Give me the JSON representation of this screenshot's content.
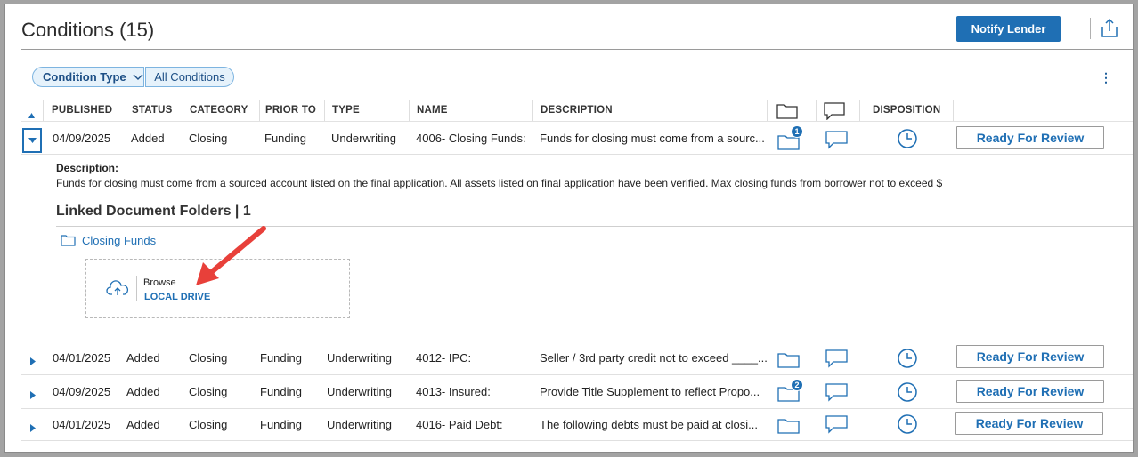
{
  "page": {
    "title": "Conditions (15)",
    "notify_label": "Notify Lender",
    "share_icon": "share-export-icon"
  },
  "filters": {
    "condition_type_label": "Condition Type",
    "all_conditions_label": "All Conditions"
  },
  "table": {
    "columns": [
      "PUBLISHED",
      "STATUS",
      "CATEGORY",
      "PRIOR TO",
      "TYPE",
      "NAME",
      "DESCRIPTION",
      "DISPOSITION"
    ],
    "action_label": "Ready For Review",
    "rows": [
      {
        "published": "04/09/2025",
        "status": "Added",
        "category": "Closing",
        "prior_to": "Funding",
        "type": "Underwriting",
        "name": "4006- Closing Funds:",
        "description": "Funds for closing must come from a sourc...",
        "folder_count": "1"
      },
      {
        "published": "04/01/2025",
        "status": "Added",
        "category": "Closing",
        "prior_to": "Funding",
        "type": "Underwriting",
        "name": "4012- IPC:",
        "description": "Seller / 3rd party credit not to exceed ____...",
        "folder_count": ""
      },
      {
        "published": "04/09/2025",
        "status": "Added",
        "category": "Closing",
        "prior_to": "Funding",
        "type": "Underwriting",
        "name": "4013- Insured:",
        "description": "Provide Title Supplement to reflect Propo...",
        "folder_count": "2"
      },
      {
        "published": "04/01/2025",
        "status": "Added",
        "category": "Closing",
        "prior_to": "Funding",
        "type": "Underwriting",
        "name": "4016- Paid Debt:",
        "description": "The following debts must be paid at closi...",
        "folder_count": ""
      }
    ]
  },
  "expanded": {
    "description_label": "Description:",
    "description_text": "Funds for closing must come from a sourced account listed on the final application.  All assets listed on final application have been verified. Max closing funds from borrower not to exceed $",
    "linked_folders_title": "Linked Document Folders | 1",
    "folder_name": "Closing Funds",
    "browse_label": "Browse",
    "local_drive_label": "LOCAL DRIVE"
  },
  "colors": {
    "accent": "#1f6fb4",
    "annotation_arrow": "#e8403a"
  }
}
